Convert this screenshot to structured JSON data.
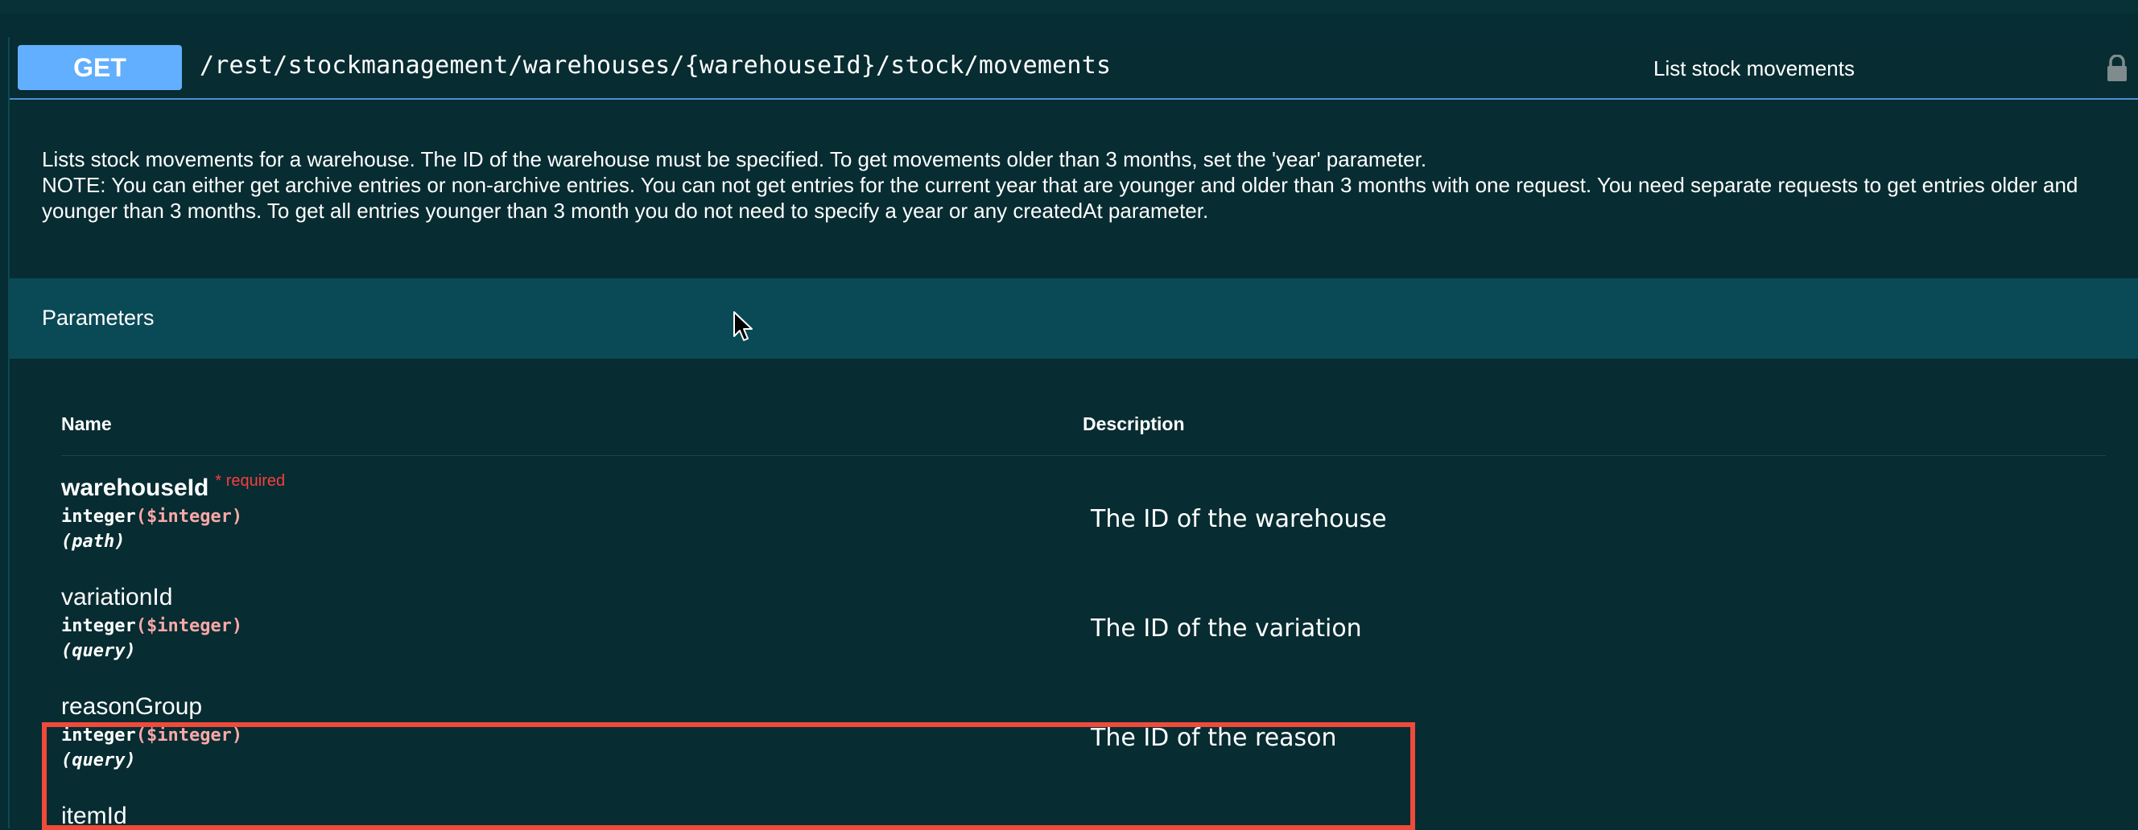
{
  "operation": {
    "method": "GET",
    "path": "/rest/stockmanagement/warehouses/{warehouseId}/stock/movements",
    "summary": "List stock movements",
    "lock_icon": "lock-icon"
  },
  "description": {
    "line1": "Lists stock movements for a warehouse. The ID of the warehouse must be specified. To get movements older than 3 months, set the 'year' parameter.",
    "line2": "NOTE: You can either get archive entries or non-archive entries. You can not get entries for the current year that are younger and older than 3 months with one request. You need separate requests to get entries older and younger than 3 months. To get all entries younger than 3 month you do not need to specify a year or any createdAt parameter."
  },
  "parameters": {
    "title": "Parameters",
    "col_name": "Name",
    "col_description": "Description",
    "required_label": "required",
    "required_star": "*",
    "items": [
      {
        "name": "warehouseId",
        "type": "integer",
        "format": "($integer)",
        "in": "(path)",
        "description": "The ID of the warehouse",
        "required": true
      },
      {
        "name": "variationId",
        "type": "integer",
        "format": "($integer)",
        "in": "(query)",
        "description": "The ID of the variation",
        "required": false
      },
      {
        "name": "reasonGroup",
        "type": "integer",
        "format": "($integer)",
        "in": "(query)",
        "description": "The ID of the reason",
        "required": false
      },
      {
        "name": "itemId",
        "type": "",
        "format": "",
        "in": "",
        "description": "",
        "required": false
      }
    ]
  },
  "colors": {
    "background": "#052d33",
    "method_get": "#61affe",
    "params_header": "#0a4a57",
    "highlight": "#ee4b3b",
    "required": "#f93e3e",
    "format": "#f9a8a8"
  }
}
